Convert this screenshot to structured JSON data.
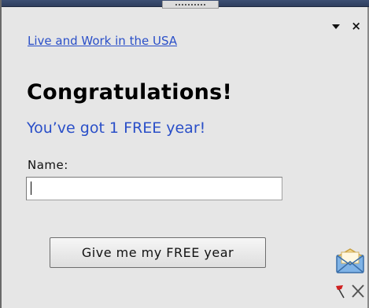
{
  "header": {
    "link_text": "Live and Work in the USA"
  },
  "main": {
    "headline": "Congratulations!",
    "subhead": "You’ve got 1 FREE year!",
    "name_label": "Name:",
    "name_value": "",
    "submit_label": "Give me my FREE year"
  },
  "icons": {
    "dropdown": "chevron-down-icon",
    "close": "close-icon",
    "mail": "envelope-icon",
    "flag": "flag-icon",
    "dismiss": "dismiss-icon"
  },
  "colors": {
    "accent": "#2a4fc8",
    "background": "#e6e6e6",
    "top_bar": "#3d4f73"
  }
}
